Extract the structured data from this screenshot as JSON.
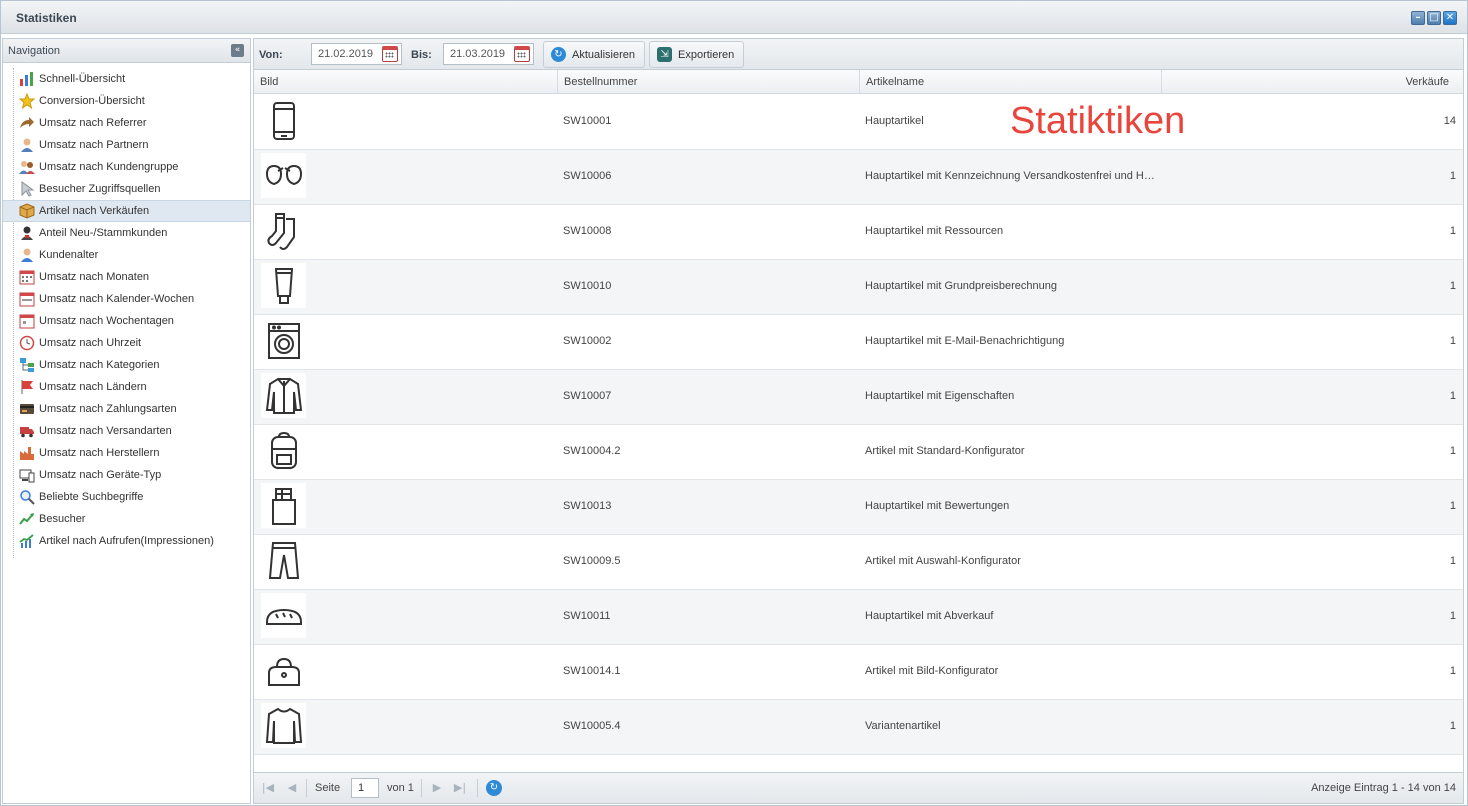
{
  "window": {
    "title": "Statistiken"
  },
  "sidebar": {
    "title": "Navigation",
    "items": [
      {
        "label": "Schnell-Übersicht",
        "icon": "bar-chart-icon"
      },
      {
        "label": "Conversion-Übersicht",
        "icon": "star-icon"
      },
      {
        "label": "Umsatz nach Referrer",
        "icon": "arrow-icon"
      },
      {
        "label": "Umsatz nach Partnern",
        "icon": "partner-icon"
      },
      {
        "label": "Umsatz nach Kundengruppe",
        "icon": "group-icon"
      },
      {
        "label": "Besucher Zugriffsquellen",
        "icon": "cursor-icon"
      },
      {
        "label": "Artikel nach Verkäufen",
        "icon": "box-icon",
        "selected": true
      },
      {
        "label": "Anteil Neu-/Stammkunden",
        "icon": "customer-icon"
      },
      {
        "label": "Kundenalter",
        "icon": "user-icon"
      },
      {
        "label": "Umsatz nach Monaten",
        "icon": "calendar-month-icon"
      },
      {
        "label": "Umsatz nach Kalender-Wochen",
        "icon": "calendar-week-icon"
      },
      {
        "label": "Umsatz nach Wochentagen",
        "icon": "calendar-day-icon"
      },
      {
        "label": "Umsatz nach Uhrzeit",
        "icon": "clock-icon"
      },
      {
        "label": "Umsatz nach Kategorien",
        "icon": "tree-icon"
      },
      {
        "label": "Umsatz nach Ländern",
        "icon": "flag-icon"
      },
      {
        "label": "Umsatz nach Zahlungsarten",
        "icon": "credit-card-icon"
      },
      {
        "label": "Umsatz nach Versandarten",
        "icon": "truck-icon"
      },
      {
        "label": "Umsatz nach Herstellern",
        "icon": "factory-icon"
      },
      {
        "label": "Umsatz nach Geräte-Typ",
        "icon": "devices-icon"
      },
      {
        "label": "Beliebte Suchbegriffe",
        "icon": "magnifier-icon"
      },
      {
        "label": "Besucher",
        "icon": "trend-icon"
      },
      {
        "label": "Artikel nach Aufrufen(Impressionen)",
        "icon": "trend-bars-icon"
      }
    ]
  },
  "toolbar": {
    "from_label": "Von:",
    "from_value": "21.02.2019",
    "to_label": "Bis:",
    "to_value": "21.03.2019",
    "refresh_label": "Aktualisieren",
    "export_label": "Exportieren"
  },
  "grid": {
    "columns": [
      "Bild",
      "Bestellnummer",
      "Artikelname",
      "Verkäufe"
    ],
    "rows": [
      {
        "image": "phone-icon",
        "number": "SW10001",
        "name": "Hauptartikel",
        "sales": "14"
      },
      {
        "image": "gloves-icon",
        "number": "SW10006",
        "name": "Hauptartikel mit Kennzeichnung Versandkostenfrei und H…",
        "sales": "1"
      },
      {
        "image": "socks-icon",
        "number": "SW10008",
        "name": "Hauptartikel mit Ressourcen",
        "sales": "1"
      },
      {
        "image": "tube-icon",
        "number": "SW10010",
        "name": "Hauptartikel mit Grundpreisberechnung",
        "sales": "1"
      },
      {
        "image": "washing-machine-icon",
        "number": "SW10002",
        "name": "Hauptartikel mit E-Mail-Benachrichtigung",
        "sales": "1"
      },
      {
        "image": "jacket-icon",
        "number": "SW10007",
        "name": "Hauptartikel mit Eigenschaften",
        "sales": "1"
      },
      {
        "image": "backpack-icon",
        "number": "SW10004.2",
        "name": "Artikel mit Standard-Konfigurator",
        "sales": "1"
      },
      {
        "image": "chocolate-icon",
        "number": "SW10013",
        "name": "Hauptartikel mit Bewertungen",
        "sales": "1"
      },
      {
        "image": "trousers-icon",
        "number": "SW10009.5",
        "name": "Artikel mit Auswahl-Konfigurator",
        "sales": "1"
      },
      {
        "image": "bread-icon",
        "number": "SW10011",
        "name": "Hauptartikel mit Abverkauf",
        "sales": "1"
      },
      {
        "image": "bag-icon",
        "number": "SW10014.1",
        "name": "Artikel mit Bild-Konfigurator",
        "sales": "1"
      },
      {
        "image": "sweater-icon",
        "number": "SW10005.4",
        "name": "Variantenartikel",
        "sales": "1"
      }
    ]
  },
  "overlay_text": "Statiktiken",
  "pager": {
    "page_label": "Seite",
    "page_value": "1",
    "of_label": "von 1",
    "info": "Anzeige Eintrag 1 - 14 von 14"
  },
  "colors": {
    "accent": "#2c8ad6",
    "overlay": "#e8453c",
    "selected_row": "#dfe8f1"
  }
}
